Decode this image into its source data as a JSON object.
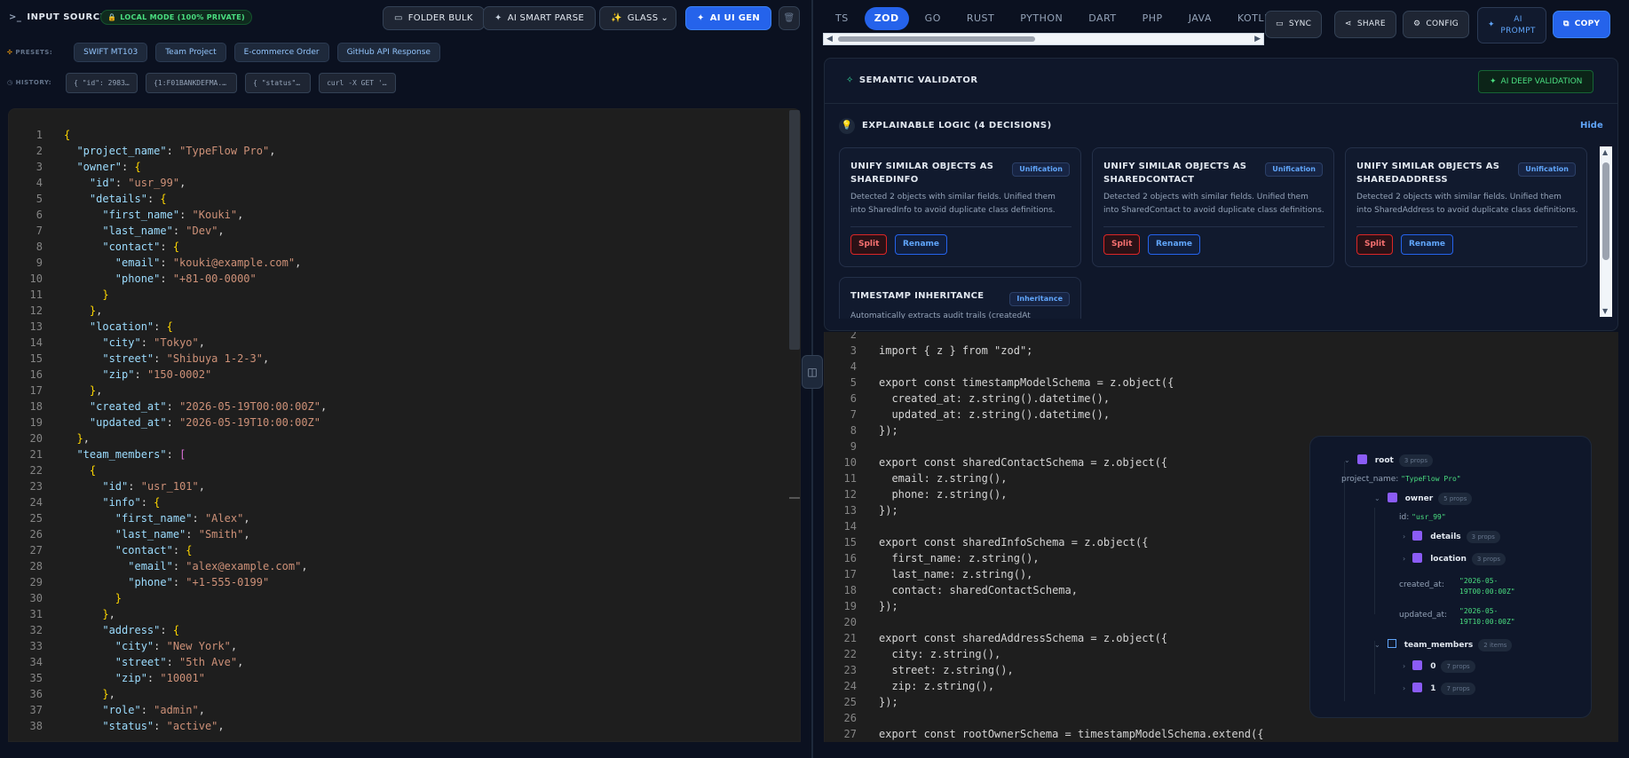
{
  "left": {
    "title": "INPUT SOURCE",
    "title_icon": ">_",
    "badge": "LOCAL MODE (100% PRIVATE)",
    "buttons": {
      "folder_bulk": "FOLDER BULK",
      "smart_parse": "AI SMART PARSE",
      "glass": "GLASS",
      "ui_gen": "AI UI GEN"
    },
    "presets_label": "PRESETS:",
    "presets": [
      "SWIFT MT103",
      "Team Project",
      "E-commerce Order",
      "GitHub API Response"
    ],
    "history_label": "HISTORY:",
    "history": [
      "{ \"id\": 29837...",
      "{1:F01BANKDEFMA...",
      "{ \"status\": \"...",
      "curl -X GET 'ht..."
    ],
    "code": [
      "{",
      "  \"project_name\": \"TypeFlow Pro\",",
      "  \"owner\": {",
      "    \"id\": \"usr_99\",",
      "    \"details\": {",
      "      \"first_name\": \"Kouki\",",
      "      \"last_name\": \"Dev\",",
      "      \"contact\": {",
      "        \"email\": \"kouki@example.com\",",
      "        \"phone\": \"+81-00-0000\"",
      "      }",
      "    },",
      "    \"location\": {",
      "      \"city\": \"Tokyo\",",
      "      \"street\": \"Shibuya 1-2-3\",",
      "      \"zip\": \"150-0002\"",
      "    },",
      "    \"created_at\": \"2026-05-19T00:00:00Z\",",
      "    \"updated_at\": \"2026-05-19T10:00:00Z\"",
      "  },",
      "  \"team_members\": [",
      "    {",
      "      \"id\": \"usr_101\",",
      "      \"info\": {",
      "        \"first_name\": \"Alex\",",
      "        \"last_name\": \"Smith\",",
      "        \"contact\": {",
      "          \"email\": \"alex@example.com\",",
      "          \"phone\": \"+1-555-0199\"",
      "        }",
      "      },",
      "      \"address\": {",
      "        \"city\": \"New York\",",
      "        \"street\": \"5th Ave\",",
      "        \"zip\": \"10001\"",
      "      },",
      "      \"role\": \"admin\",",
      "      \"status\": \"active\","
    ]
  },
  "right": {
    "tabs": [
      "TS",
      "ZOD",
      "GO",
      "RUST",
      "PYTHON",
      "DART",
      "PHP",
      "JAVA",
      "KOTLIN"
    ],
    "active_tab": "ZOD",
    "buttons": {
      "sync": "SYNC",
      "share": "SHARE",
      "config": "CONFIG",
      "ai_prompt_1": "AI",
      "ai_prompt_2": "PROMPT",
      "copy": "COPY"
    },
    "validator": {
      "title": "SEMANTIC VALIDATOR",
      "deep_btn": "AI DEEP VALIDATION",
      "logic_title": "EXPLAINABLE LOGIC (4 DECISIONS)",
      "hide": "Hide",
      "cards": [
        {
          "title": "UNIFY SIMILAR OBJECTS AS SHAREDINFO",
          "tag": "Unification",
          "desc": "Detected 2 objects with similar fields. Unified them into SharedInfo to avoid duplicate class definitions.",
          "split": "Split",
          "rename": "Rename"
        },
        {
          "title": "UNIFY SIMILAR OBJECTS AS SHAREDCONTACT",
          "tag": "Unification",
          "desc": "Detected 2 objects with similar fields. Unified them into SharedContact to avoid duplicate class definitions.",
          "split": "Split",
          "rename": "Rename"
        },
        {
          "title": "UNIFY SIMILAR OBJECTS AS SHAREDADDRESS",
          "tag": "Unification",
          "desc": "Detected 2 objects with similar fields. Unified them into SharedAddress to avoid duplicate class definitions.",
          "split": "Split",
          "rename": "Rename"
        },
        {
          "title": "TIMESTAMP INHERITANCE",
          "tag": "Inheritance",
          "desc": "Automatically extracts audit trails (createdAt"
        }
      ]
    },
    "code_start": 2,
    "code": [
      "",
      "import { z } from \"zod\";",
      "",
      "export const timestampModelSchema = z.object({",
      "  created_at: z.string().datetime(),",
      "  updated_at: z.string().datetime(),",
      "});",
      "",
      "export const sharedContactSchema = z.object({",
      "  email: z.string(),",
      "  phone: z.string(),",
      "});",
      "",
      "export const sharedInfoSchema = z.object({",
      "  first_name: z.string(),",
      "  last_name: z.string(),",
      "  contact: sharedContactSchema,",
      "});",
      "",
      "export const sharedAddressSchema = z.object({",
      "  city: z.string(),",
      "  street: z.string(),",
      "  zip: z.string(),",
      "});",
      "",
      "export const rootOwnerSchema = timestampModelSchema.extend({"
    ],
    "tree": {
      "root": "root",
      "root_count": "3 props",
      "project_name_key": "project_name:",
      "project_name_val": "\"TypeFlow Pro\"",
      "owner": "owner",
      "owner_count": "5 props",
      "id_key": "id:",
      "id_val": "\"usr_99\"",
      "details": "details",
      "details_count": "3 props",
      "location": "location",
      "location_count": "3 props",
      "created_key": "created_at:",
      "created_val_1": "\"2026-05-",
      "created_val_2": "19T00:00:00Z\"",
      "updated_key": "updated_at:",
      "updated_val_1": "\"2026-05-",
      "updated_val_2": "19T10:00:00Z\"",
      "team": "team_members",
      "team_count": "2 items",
      "m0": "0",
      "m0_count": "7 props",
      "m1": "1",
      "m1_count": "7 props"
    }
  },
  "colors": {
    "accent": "#2563eb",
    "success": "#4ade80",
    "danger": "#f87171",
    "editor_bg": "#1e1e1e"
  }
}
